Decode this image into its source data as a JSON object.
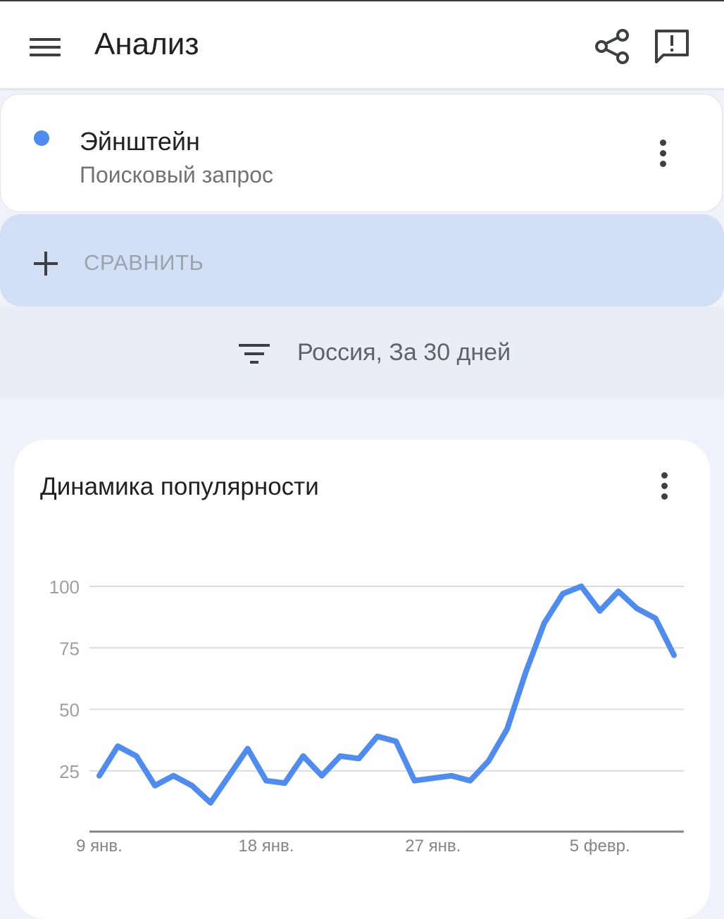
{
  "appbar": {
    "title": "Анализ",
    "menu_icon": "menu-icon",
    "share_icon": "share-icon",
    "feedback_icon": "feedback-icon"
  },
  "term": {
    "name": "Эйнштейн",
    "type": "Поисковый запрос",
    "dot_color": "#4e8cf1"
  },
  "compare": {
    "label": "СРАВНИТЬ",
    "icon": "plus-icon"
  },
  "filter": {
    "text": "Россия, За 30 дней",
    "icon": "filter-icon"
  },
  "chart_card": {
    "title": "Динамика популярности"
  },
  "colors": {
    "accent": "#4e8cf1",
    "compare_bg": "#d3dff5",
    "page_bg": "#eff2f9"
  },
  "chart_data": {
    "type": "line",
    "title": "Динамика популярности",
    "xlabel": "",
    "ylabel": "",
    "ylim": [
      0,
      100
    ],
    "yticks": [
      25,
      50,
      75,
      100
    ],
    "xtick_labels": [
      "9 янв.",
      "18 янв.",
      "27 янв.",
      "5 февр."
    ],
    "grid": true,
    "series": [
      {
        "name": "Эйнштейн",
        "color": "#4e8cf1",
        "values": [
          23,
          35,
          31,
          19,
          23,
          19,
          12,
          23,
          34,
          21,
          20,
          31,
          23,
          31,
          30,
          39,
          37,
          21,
          22,
          23,
          21,
          29,
          42,
          65,
          85,
          97,
          100,
          90,
          98,
          91,
          87,
          72
        ]
      }
    ]
  }
}
